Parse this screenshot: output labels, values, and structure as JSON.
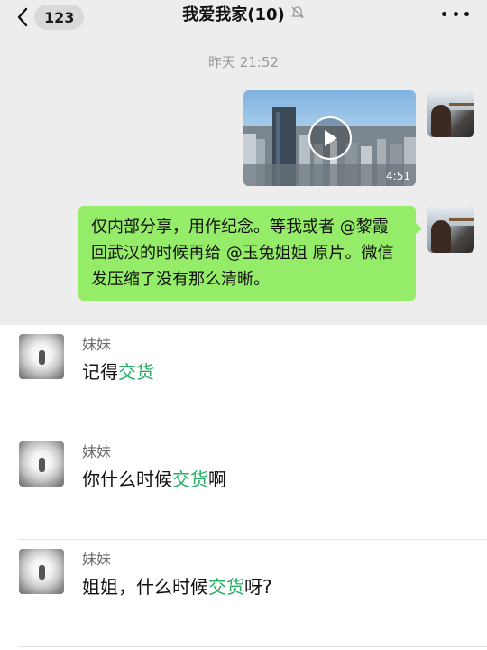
{
  "navbar": {
    "unread_count": "123",
    "title": "我爱我家(10)",
    "icons": {
      "back": "chevron-left-icon",
      "mute": "bell-off-icon",
      "more": "more-dots-icon"
    }
  },
  "chat": {
    "timestamp": "昨天 21:52",
    "video": {
      "duration": "4:51",
      "icon": "play-icon"
    },
    "message": "仅内部分享，用作纪念。等我或者 @黎霞 回武汉的时候再给 @玉兔姐姐 原片。微信发压缩了没有那么清晰。"
  },
  "comments": [
    {
      "name": "妹妹",
      "before": "记得",
      "highlight": "交货",
      "after": ""
    },
    {
      "name": "妹妹",
      "before": "你什么时候",
      "highlight": "交货",
      "after": "啊"
    },
    {
      "name": "妹妹",
      "before": "姐姐，什么时候",
      "highlight": "交货",
      "after": "呀?"
    }
  ],
  "colors": {
    "chat_bg": "#ededed",
    "bubble": "#95ec69",
    "highlight": "#2aae67",
    "timestamp": "#9a9a9a"
  }
}
